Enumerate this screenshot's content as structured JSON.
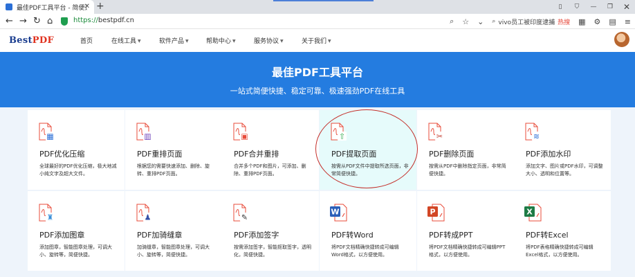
{
  "browser": {
    "tab_title": "最佳PDF工具平台 - 简便迅捷",
    "url_protocol": "https://",
    "url_host": "bestpdf.cn",
    "search_text": "vivo员工被印度逮捕",
    "search_badge": "热搜"
  },
  "site": {
    "logo_part1": "Best",
    "logo_part2": "PDF",
    "menu": [
      {
        "label": "首页"
      },
      {
        "label": "在线工具"
      },
      {
        "label": "软件产品"
      },
      {
        "label": "帮助中心"
      },
      {
        "label": "服务协议"
      },
      {
        "label": "关于我们"
      }
    ]
  },
  "banner": {
    "title": "最佳PDF工具平台",
    "subtitle": "一站式简便快捷、稳定可靠、极速强劲PDF在线工具"
  },
  "tools": [
    {
      "name": "PDF优化压缩",
      "desc": "全球最好的PDF优化压缩，极大地减小纯文字及超大文件。",
      "icon": "pdf-compress-icon",
      "color": "#2b6fd6"
    },
    {
      "name": "PDF重排页面",
      "desc": "根据您的需要快速添加、删除、旋转、重排PDF页面。",
      "icon": "pdf-rearrange-icon",
      "color": "#6a3fb8"
    },
    {
      "name": "PDF合并重排",
      "desc": "合并多个PDF和图片，可添加、删除、重排PDF页面。",
      "icon": "pdf-merge-icon",
      "color": "#e84b3a"
    },
    {
      "name": "PDF提取页面",
      "desc": "按需从PDF文件中提取所选页面，非常简便快捷。",
      "icon": "pdf-extract-icon",
      "color": "#2aa84a"
    },
    {
      "name": "PDF删除页面",
      "desc": "按需从PDF中删除指定页面，非常简便快捷。",
      "icon": "pdf-delete-icon",
      "color": "#c0392b"
    },
    {
      "name": "PDF添加水印",
      "desc": "添加文字、图片或PDF水印，可调整大小、透明和位置等。",
      "icon": "pdf-watermark-icon",
      "color": "#2b6fd6"
    },
    {
      "name": "PDF添加图章",
      "desc": "添加图章，智能图章处理，可调大小、旋转等，简便快捷。",
      "icon": "pdf-stamp-icon",
      "color": "#3a8fd8"
    },
    {
      "name": "PDF加骑缝章",
      "desc": "加骑缝章，智能图章处理，可调大小、旋转等，简便快捷。",
      "icon": "pdf-seam-stamp-icon",
      "color": "#3451a8"
    },
    {
      "name": "PDF添加签字",
      "desc": "按需添加签字，智能抠取签字，透明化，简便快捷。",
      "icon": "pdf-signature-icon",
      "color": "#333333"
    },
    {
      "name": "PDF转Word",
      "desc": "将PDF文档精确快捷转成可编辑Word格式，以方便使用。",
      "icon": "word-icon",
      "color": "#2b5fb8"
    },
    {
      "name": "PDF转成PPT",
      "desc": "将PDF文档精确快捷转成可编辑PPT格式，以方便使用。",
      "icon": "ppt-icon",
      "color": "#d24625"
    },
    {
      "name": "PDF转Excel",
      "desc": "将PDF表格精确快捷转成可编辑Excel格式，以方便使用。",
      "icon": "excel-icon",
      "color": "#1e7b45"
    }
  ]
}
